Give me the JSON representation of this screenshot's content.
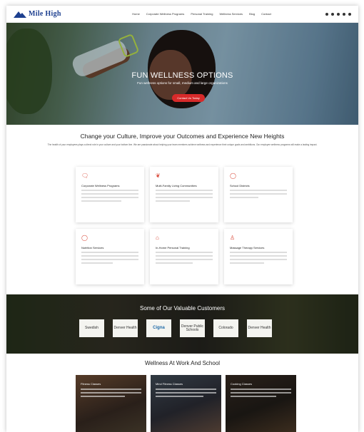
{
  "header": {
    "logo_text": "Mile High",
    "nav": [
      "Home",
      "Corporate Wellness Programs",
      "Personal Training",
      "Wellness Services",
      "Blog",
      "Contact"
    ],
    "social_icons": [
      "facebook-icon",
      "twitter-icon",
      "linkedin-icon",
      "instagram-icon",
      "youtube-icon"
    ]
  },
  "hero": {
    "title": "FUN WELLNESS OPTIONS",
    "subtitle": "Fun wellness options for small, medium and large organizations",
    "button": "Contact Us Today"
  },
  "culture": {
    "title": "Change your Culture, Improve your Outcomes and Experience New Heights",
    "body": "The health of your employees plays a direct role in your culture and your bottom line. We are passionate about helping your team members achieve wellness and experience their unique goals and ambitions. Our employee wellness programs will make a lasting impact."
  },
  "services": [
    {
      "icon": "chat-bubble-icon",
      "title": "Corporate Wellness Programs"
    },
    {
      "icon": "hands-icon",
      "title": "Multi-Family Living Communities"
    },
    {
      "icon": "circle-icon",
      "title": "School Districts"
    },
    {
      "icon": "apple-icon",
      "title": "Nutrition Services"
    },
    {
      "icon": "house-icon",
      "title": "In-Home Personal Training"
    },
    {
      "icon": "person-icon",
      "title": "Massage Therapy Services"
    }
  ],
  "customers": {
    "title": "Some of Our Valuable Customers",
    "logos": [
      "Swedish",
      "Denver Health",
      "Cigna",
      "Denver Public Schools",
      "Colorado",
      "Denver Health"
    ]
  },
  "wellness": {
    "title": "Wellness At Work And School",
    "cards": [
      "Fitness Classes",
      "Mind Fitness Classes",
      "Cooking Classes"
    ]
  },
  "colors": {
    "accent": "#d72a2a",
    "brand": "#1d3f8f"
  }
}
